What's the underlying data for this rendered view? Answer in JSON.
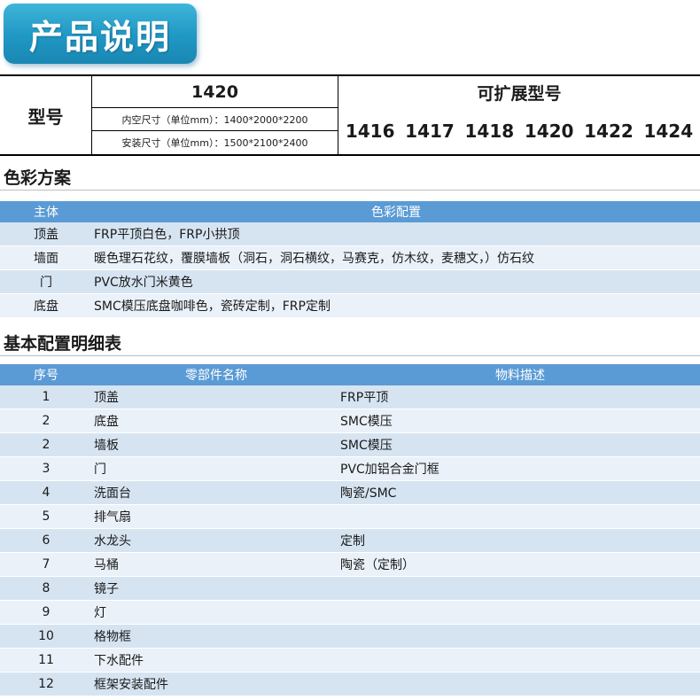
{
  "header": {
    "title": "产品说明"
  },
  "model": {
    "label": "型号",
    "value": "1420",
    "inner_size": "内空尺寸（单位mm）：1400*2000*2200",
    "install_size": "安装尺寸（单位mm）：1500*2100*2400",
    "ext_title": "可扩展型号",
    "ext_models": [
      "1416",
      "1417",
      "1418",
      "1420",
      "1422",
      "1424"
    ]
  },
  "color_scheme": {
    "title": "色彩方案",
    "headers": [
      "主体",
      "色彩配置"
    ],
    "rows": [
      [
        "顶盖",
        "FRP平顶白色，FRP小拱顶"
      ],
      [
        "墙面",
        "暖色理石花纹，覆膜墙板（洞石，洞石横纹，马赛克，仿木纹，麦穗文，）仿石纹"
      ],
      [
        "门",
        "PVC放水门米黄色"
      ],
      [
        "底盘",
        "SMC模压底盘咖啡色，瓷砖定制，FRP定制"
      ]
    ]
  },
  "parts": {
    "title": "基本配置明细表",
    "headers": [
      "序号",
      "零部件名称",
      "物料描述"
    ],
    "rows": [
      [
        "1",
        "顶盖",
        "FRP平顶"
      ],
      [
        "2",
        "底盘",
        "SMC模压"
      ],
      [
        "2",
        "墙板",
        "SMC模压"
      ],
      [
        "3",
        "门",
        "PVC加铝合金门框"
      ],
      [
        "4",
        "洗面台",
        "陶瓷/SMC"
      ],
      [
        "5",
        "排气扇",
        ""
      ],
      [
        "6",
        "水龙头",
        "定制"
      ],
      [
        "7",
        "马桶",
        "陶瓷（定制）"
      ],
      [
        "8",
        "镜子",
        ""
      ],
      [
        "9",
        "灯",
        ""
      ],
      [
        "10",
        "格物框",
        ""
      ],
      [
        "11",
        "下水配件",
        ""
      ],
      [
        "12",
        "框架安装配件",
        ""
      ]
    ]
  }
}
